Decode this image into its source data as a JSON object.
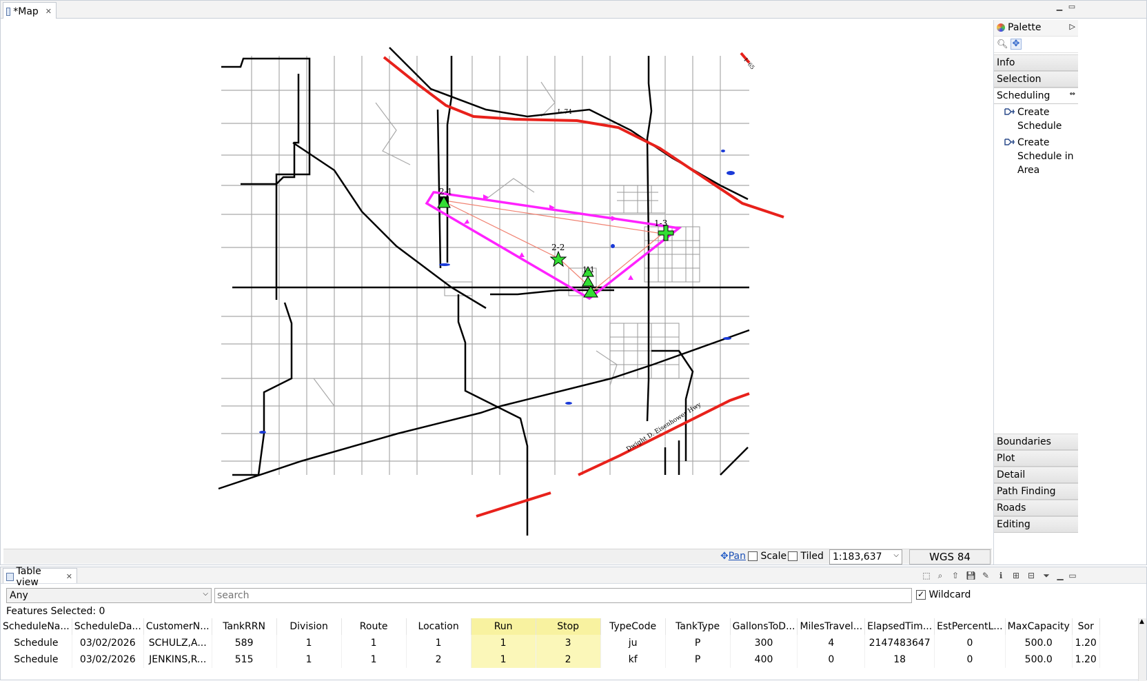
{
  "map_editor": {
    "tab_title": "*Map",
    "palette": {
      "title": "Palette",
      "drawers_top": [
        "Info",
        "Selection",
        "Scheduling"
      ],
      "scheduling_tools": [
        "Create Schedule",
        "Create Schedule in Area"
      ],
      "drawers_bottom": [
        "Boundaries",
        "Plot",
        "Detail",
        "Path Finding",
        "Roads",
        "Editing"
      ]
    },
    "map_labels": {
      "highway_1": "I- 74",
      "highway_2": "I- 65",
      "highway_3": "Dwight D. Eisenhower Hwy"
    },
    "stops": [
      "2-1",
      "2-2",
      "1-3",
      "1-1"
    ],
    "status": {
      "pan_label": "Pan",
      "scale_label": "Scale",
      "tiled_label": "Tiled",
      "scale_value": "1:183,637",
      "crs": "WGS 84"
    },
    "colors": {
      "route": "#ff22ff",
      "interstate": "#e8211b",
      "road": "#000000",
      "stop_marker": "#33dd33"
    }
  },
  "table_view": {
    "tab_title": "Table view",
    "filter_value": "Any",
    "search_placeholder": "search",
    "wildcard_label": "Wildcard",
    "features_selected": "Features Selected: 0",
    "columns": [
      "ScheduleNa...",
      "ScheduleDa...",
      "CustomerN...",
      "TankRRN",
      "Division",
      "Route",
      "Location",
      "Run",
      "Stop",
      "TypeCode",
      "TankType",
      "GallonsToD...",
      "MilesTravel...",
      "ElapsedTim...",
      "EstPercentL...",
      "MaxCapacity",
      "Sor"
    ],
    "rows": [
      [
        "Schedule",
        "03/02/2026",
        "SCHULZ,A...",
        "589",
        "1",
        "1",
        "1",
        "1",
        "3",
        "ju",
        "P",
        "300",
        "4",
        "2147483647",
        "0",
        "500.0",
        "1.20"
      ],
      [
        "Schedule",
        "03/02/2026",
        "JENKINS,R...",
        "515",
        "1",
        "1",
        "2",
        "1",
        "2",
        "kf",
        "P",
        "400",
        "0",
        "18",
        "0",
        "500.0",
        "1.20"
      ]
    ]
  }
}
